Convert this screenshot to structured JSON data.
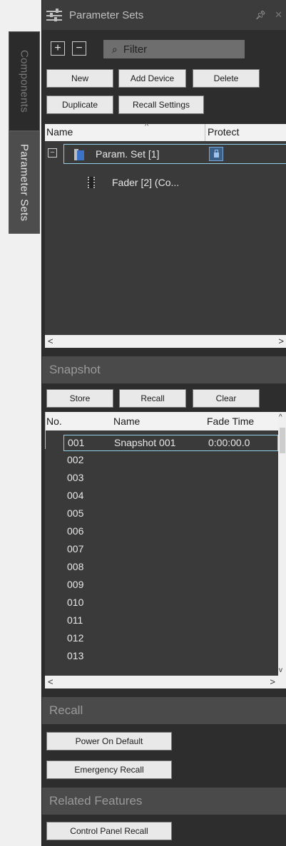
{
  "side_tabs": {
    "components": "Components",
    "parameter_sets": "Parameter Sets"
  },
  "titlebar": {
    "title": "Parameter Sets",
    "icon": "sliders-icon",
    "pin": "pin-icon",
    "close": "close-icon"
  },
  "toolbar": {
    "expand": "+",
    "collapse": "−",
    "filter_placeholder": "Filter"
  },
  "param_buttons": {
    "new": "New",
    "add_device": "Add Device",
    "delete": "Delete",
    "duplicate": "Duplicate",
    "recall_settings": "Recall Settings"
  },
  "tree": {
    "columns": [
      "Name",
      "Protect"
    ],
    "rows": [
      {
        "label": "Param. Set [1]",
        "icon": "parameter-set-icon",
        "protect_icon": "unlock-icon"
      },
      {
        "label": "Fader [2] (Co...",
        "icon": "chip-icon"
      }
    ],
    "scroll_left": "<",
    "scroll_right": ">"
  },
  "snapshot": {
    "title": "Snapshot",
    "buttons": {
      "store": "Store",
      "recall": "Recall",
      "clear": "Clear"
    },
    "columns": [
      "No.",
      "Name",
      "Fade Time"
    ],
    "rows": [
      {
        "no": "001",
        "name": "Snapshot 001",
        "fade": "0:00:00.0"
      },
      {
        "no": "002",
        "name": "",
        "fade": ""
      },
      {
        "no": "003",
        "name": "",
        "fade": ""
      },
      {
        "no": "004",
        "name": "",
        "fade": ""
      },
      {
        "no": "005",
        "name": "",
        "fade": ""
      },
      {
        "no": "006",
        "name": "",
        "fade": ""
      },
      {
        "no": "007",
        "name": "",
        "fade": ""
      },
      {
        "no": "008",
        "name": "",
        "fade": ""
      },
      {
        "no": "009",
        "name": "",
        "fade": ""
      },
      {
        "no": "010",
        "name": "",
        "fade": ""
      },
      {
        "no": "011",
        "name": "",
        "fade": ""
      },
      {
        "no": "012",
        "name": "",
        "fade": ""
      },
      {
        "no": "013",
        "name": "",
        "fade": ""
      }
    ],
    "scroll_up": "^",
    "scroll_down": "v",
    "scroll_left": "<",
    "scroll_right": ">"
  },
  "recall": {
    "title": "Recall",
    "power_on_default": "Power On Default",
    "emergency_recall": "Emergency Recall"
  },
  "related": {
    "title": "Related Features",
    "control_panel_recall": "Control Panel Recall"
  },
  "colors": {
    "panel_bg": "#2d2d2d",
    "list_bg": "#3a3a3a",
    "section_bg": "#4a4a4a",
    "selection_border": "#8fd0e8",
    "accent_blue": "#3b73c9"
  }
}
